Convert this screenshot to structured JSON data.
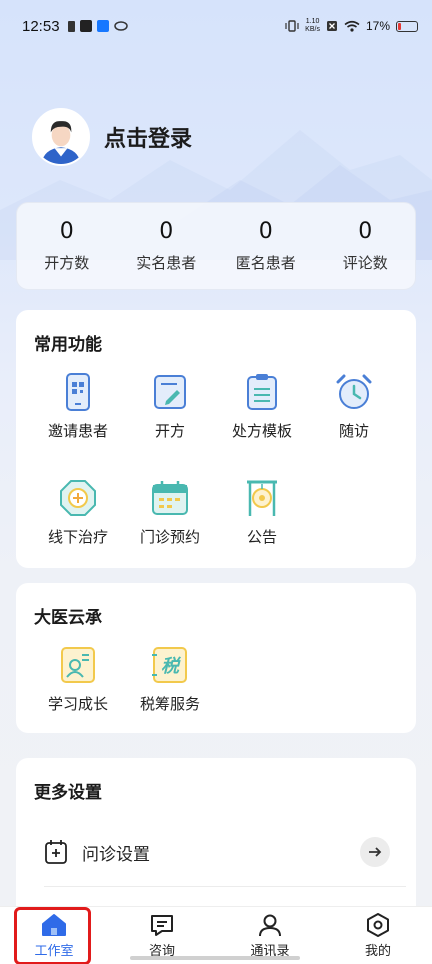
{
  "status_bar": {
    "time": "12:53",
    "net_speed_value": "1.10",
    "net_speed_unit": "KB/s",
    "battery": "17%"
  },
  "profile": {
    "login_text": "点击登录"
  },
  "stats": [
    {
      "value": "0",
      "label": "开方数"
    },
    {
      "value": "0",
      "label": "实名患者"
    },
    {
      "value": "0",
      "label": "匿名患者"
    },
    {
      "value": "0",
      "label": "评论数"
    }
  ],
  "common_functions": {
    "title": "常用功能",
    "items": [
      {
        "label": "邀请患者",
        "icon": "phone-qr-icon"
      },
      {
        "label": "开方",
        "icon": "prescribe-pen-icon"
      },
      {
        "label": "处方模板",
        "icon": "clipboard-template-icon"
      },
      {
        "label": "随访",
        "icon": "alarm-clock-icon"
      },
      {
        "label": "线下治疗",
        "icon": "offline-treatment-icon"
      },
      {
        "label": "门诊预约",
        "icon": "calendar-icon"
      },
      {
        "label": "公告",
        "icon": "gong-icon"
      }
    ]
  },
  "dayi": {
    "title": "大医云承",
    "items": [
      {
        "label": "学习成长",
        "icon": "learning-icon"
      },
      {
        "label": "税筹服务",
        "icon": "tax-service-icon",
        "glyph": "税"
      }
    ]
  },
  "more_settings": {
    "title": "更多设置",
    "rows": [
      {
        "label": "问诊设置",
        "icon": "consultation-settings-icon"
      }
    ]
  },
  "bottom_nav": [
    {
      "label": "工作室",
      "icon": "home-icon",
      "active": true
    },
    {
      "label": "咨询",
      "icon": "chat-icon",
      "active": false
    },
    {
      "label": "通讯录",
      "icon": "contacts-icon",
      "active": false
    },
    {
      "label": "我的",
      "icon": "profile-hex-icon",
      "active": false
    }
  ],
  "colors": {
    "accent_blue": "#2f6be8",
    "icon_blue": "#4a7fd6",
    "icon_teal": "#49b8b0",
    "icon_yellow": "#f2c94c",
    "active_outline": "#e11b1b"
  }
}
